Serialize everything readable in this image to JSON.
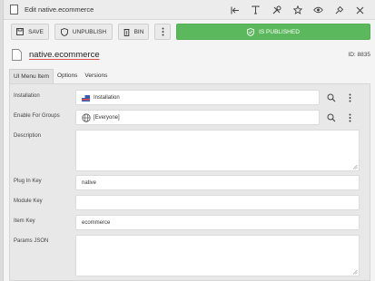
{
  "window": {
    "title": "Edit native.ecommerce"
  },
  "toolbar": {
    "save_label": "SAVE",
    "unpublish_label": "UNPUBLISH",
    "bin_label": "BIN",
    "published_label": "IS PUBLISHED"
  },
  "item": {
    "name": "native.ecommerce",
    "id_label": "ID: 8835"
  },
  "tabs": [
    {
      "label": "UI Menu Item"
    },
    {
      "label": "Options"
    },
    {
      "label": "Versions"
    }
  ],
  "fields": {
    "installation": {
      "label": "Installation",
      "value": "Installation"
    },
    "groups": {
      "label": "Enable For Groups",
      "value": "[Everyone]"
    },
    "description": {
      "label": "Description",
      "value": ""
    },
    "plugin_key": {
      "label": "Plug In Key",
      "value": "native"
    },
    "module_key": {
      "label": "Module Key",
      "value": ""
    },
    "item_key": {
      "label": "Item Key",
      "value": "ecommerce"
    },
    "params_json": {
      "label": "Params JSON",
      "value": ""
    }
  },
  "colors": {
    "published": "#5cb85c",
    "name_underline": "#d9534f"
  }
}
